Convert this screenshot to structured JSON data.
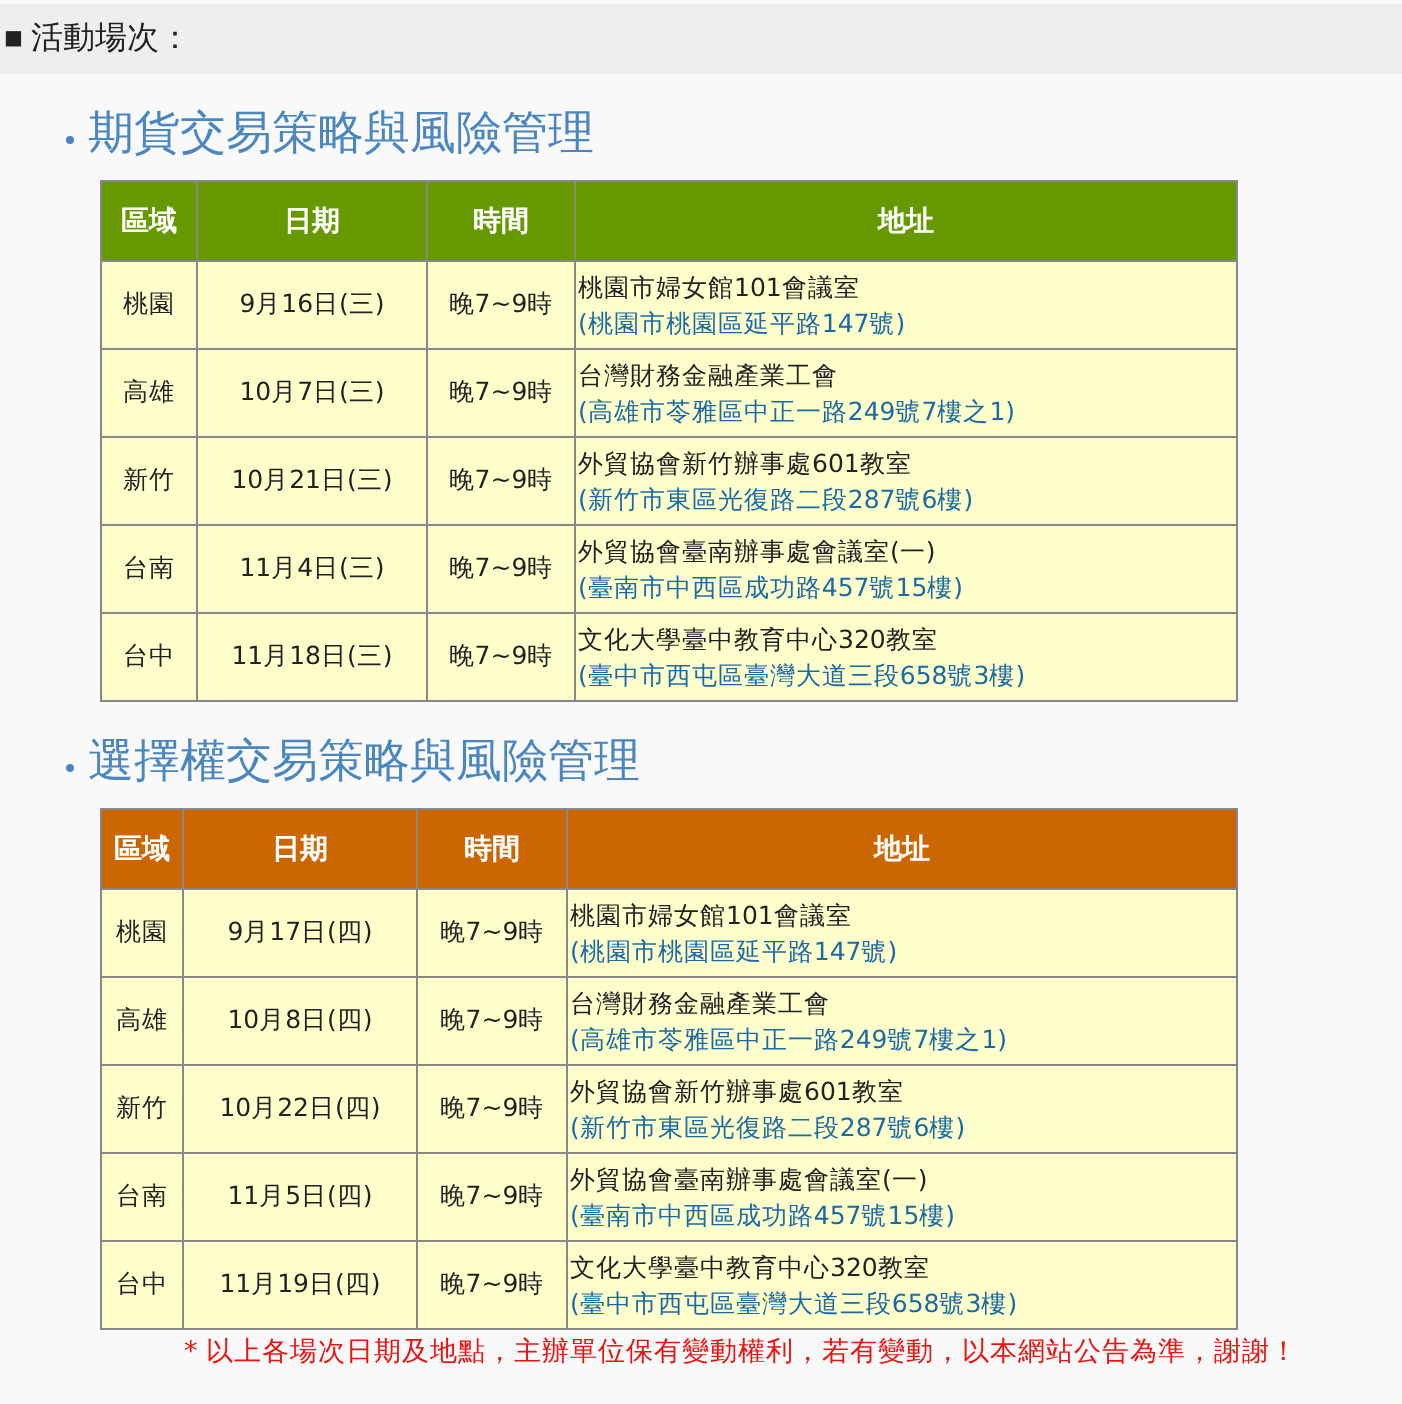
{
  "header": {
    "marker": "■",
    "title": "活動場次："
  },
  "sections": [
    {
      "title": "期貨交易策略與風險管理",
      "color": "#669900",
      "columns": [
        "區域",
        "日期",
        "時間",
        "地址"
      ],
      "rows": [
        {
          "region": "桃園",
          "date": "9月16日(三)",
          "time": "晚7~9時",
          "venue": "桃園市婦女館101會議室",
          "address": "(桃園市桃園區延平路147號)"
        },
        {
          "region": "高雄",
          "date": "10月7日(三)",
          "time": "晚7~9時",
          "venue": "台灣財務金融產業工會",
          "address": "(高雄市苓雅區中正一路249號7樓之1)"
        },
        {
          "region": "新竹",
          "date": "10月21日(三)",
          "time": "晚7~9時",
          "venue": "外貿協會新竹辦事處601教室",
          "address": "(新竹市東區光復路二段287號6樓)"
        },
        {
          "region": "台南",
          "date": "11月4日(三)",
          "time": "晚7~9時",
          "venue": "外貿協會臺南辦事處會議室(一)",
          "address": "(臺南市中西區成功路457號15樓)"
        },
        {
          "region": "台中",
          "date": "11月18日(三)",
          "time": "晚7~9時",
          "venue": "文化大學臺中教育中心320教室",
          "address": "(臺中市西屯區臺灣大道三段658號3樓)"
        }
      ]
    },
    {
      "title": "選擇權交易策略與風險管理",
      "color": "#cc6600",
      "columns": [
        "區域",
        "日期",
        "時間",
        "地址"
      ],
      "rows": [
        {
          "region": "桃園",
          "date": "9月17日(四)",
          "time": "晚7~9時",
          "venue": "桃園市婦女館101會議室",
          "address": "(桃園市桃園區延平路147號)"
        },
        {
          "region": "高雄",
          "date": "10月8日(四)",
          "time": "晚7~9時",
          "venue": "台灣財務金融產業工會",
          "address": "(高雄市苓雅區中正一路249號7樓之1)"
        },
        {
          "region": "新竹",
          "date": "10月22日(四)",
          "time": "晚7~9時",
          "venue": "外貿協會新竹辦事處601教室",
          "address": "(新竹市東區光復路二段287號6樓)"
        },
        {
          "region": "台南",
          "date": "11月5日(四)",
          "time": "晚7~9時",
          "venue": "外貿協會臺南辦事處會議室(一)",
          "address": "(臺南市中西區成功路457號15樓)"
        },
        {
          "region": "台中",
          "date": "11月19日(四)",
          "time": "晚7~9時",
          "venue": "文化大學臺中教育中心320教室",
          "address": "(臺中市西屯區臺灣大道三段658號3樓)"
        }
      ]
    }
  ],
  "footnote": "* 以上各場次日期及地點，主辦單位保有變動權利，若有變動，以本網站公告為準，謝謝！"
}
